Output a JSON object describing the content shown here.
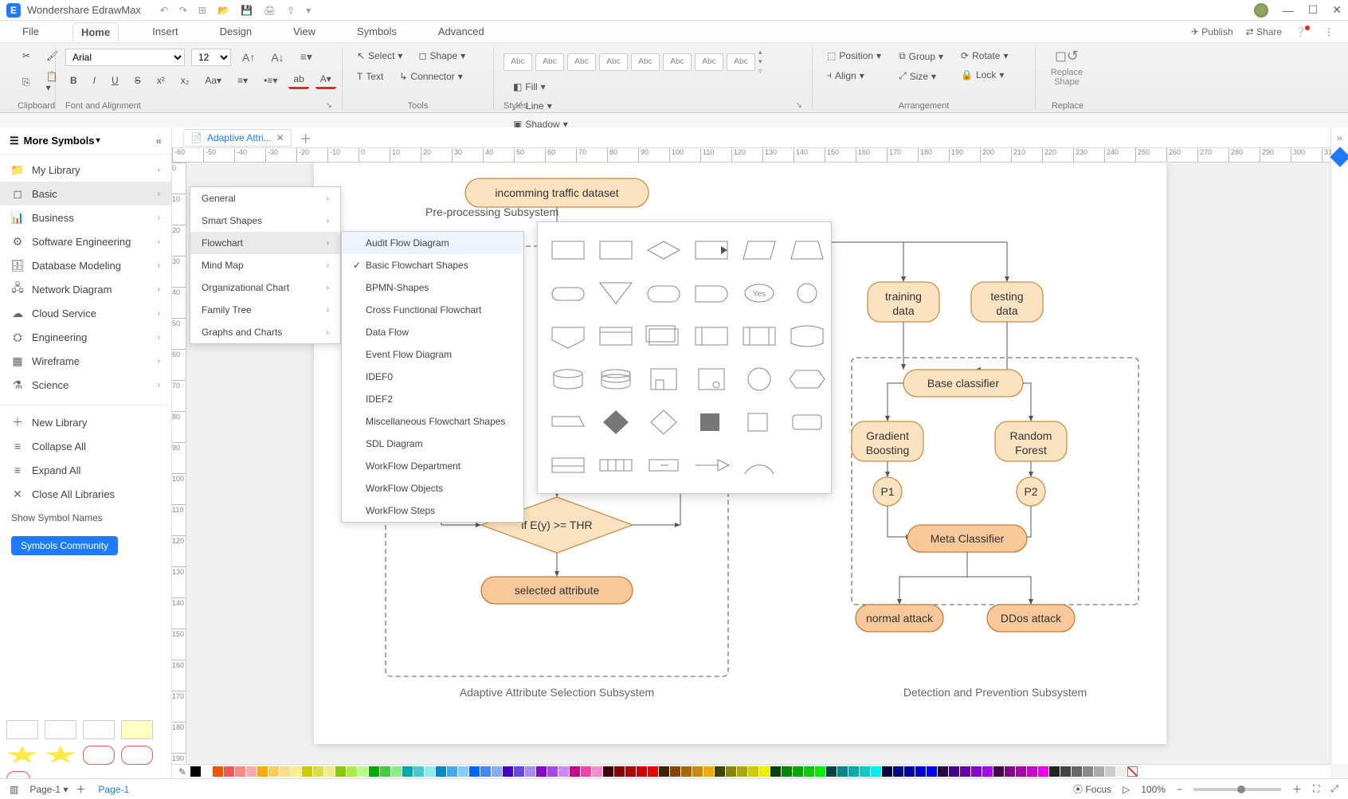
{
  "app": {
    "name": "Wondershare EdrawMax"
  },
  "menu": {
    "file": "File",
    "home": "Home",
    "insert": "Insert",
    "design": "Design",
    "view": "View",
    "symbols": "Symbols",
    "advanced": "Advanced",
    "publish": "Publish",
    "share": "Share"
  },
  "ribbon": {
    "clipboard": "Clipboard",
    "font_align": "Font and Alignment",
    "tools": "Tools",
    "styles": "Styles",
    "arrangement": "Arrangement",
    "replace": "Replace",
    "font": "Arial",
    "size": "12",
    "select": "Select",
    "shape": "Shape",
    "text": "Text",
    "connector": "Connector",
    "abc": "Abc",
    "fill": "Fill",
    "line": "Line",
    "shadow": "Shadow",
    "position": "Position",
    "align": "Align",
    "group": "Group",
    "size_btn": "Size",
    "rotate": "Rotate",
    "lock": "Lock",
    "replace_shape": "Replace\nShape"
  },
  "doctab": {
    "name": "Adaptive Attri..."
  },
  "sidebar": {
    "header": "More Symbols",
    "items": [
      {
        "icon": "📁",
        "label": "My Library"
      },
      {
        "icon": "◻",
        "label": "Basic",
        "active": true
      },
      {
        "icon": "📊",
        "label": "Business"
      },
      {
        "icon": "⚙",
        "label": "Software Engineering"
      },
      {
        "icon": "🗄",
        "label": "Database Modeling"
      },
      {
        "icon": "🖧",
        "label": "Network Diagram"
      },
      {
        "icon": "☁",
        "label": "Cloud Service"
      },
      {
        "icon": "⛭",
        "label": "Engineering"
      },
      {
        "icon": "▦",
        "label": "Wireframe"
      },
      {
        "icon": "⚗",
        "label": "Science"
      }
    ],
    "actions": [
      {
        "icon": "＋",
        "label": "New Library"
      },
      {
        "icon": "≡",
        "label": "Collapse All"
      },
      {
        "icon": "≡",
        "label": "Expand All"
      },
      {
        "icon": "✕",
        "label": "Close All Libraries"
      }
    ],
    "shownames": "Show Symbol Names",
    "community": "Symbols Community"
  },
  "submenu1": [
    "General",
    "Smart Shapes",
    "Flowchart",
    "Mind Map",
    "Organizational Chart",
    "Family Tree",
    "Graphs and Charts"
  ],
  "submenu1_active": "Flowchart",
  "submenu2": [
    {
      "label": "Audit Flow Diagram",
      "checked": false,
      "hover": true
    },
    {
      "label": "Basic Flowchart Shapes",
      "checked": true
    },
    {
      "label": "BPMN-Shapes"
    },
    {
      "label": "Cross Functional Flowchart"
    },
    {
      "label": "Data Flow"
    },
    {
      "label": "Event Flow Diagram"
    },
    {
      "label": "IDEF0"
    },
    {
      "label": "IDEF2"
    },
    {
      "label": "Miscellaneous Flowchart Shapes"
    },
    {
      "label": "SDL Diagram"
    },
    {
      "label": "WorkFlow Department"
    },
    {
      "label": "WorkFlow Objects"
    },
    {
      "label": "WorkFlow Steps"
    }
  ],
  "diagram": {
    "n_incoming": "incomming traffic dataset",
    "cap_preproc": "Pre-processing Subsystem",
    "n_training": "training\ndata",
    "n_testing": "testing\ndata",
    "n_base": "Base classifier",
    "n_gb": "Gradient\nBoosting",
    "n_rf": "Random\nForest",
    "n_p1": "P1",
    "n_p2": "P2",
    "n_meta": "Meta Classifier",
    "n_normal": "normal attack",
    "n_ddos": "DDos attack",
    "n_decision": "if E(y) >= THR",
    "n_selected": "selected attribute",
    "cap_left": "Adaptive Attribute Selection Subsystem",
    "cap_right": "Detection and Prevention Subsystem"
  },
  "gallery_yes": "Yes",
  "statusbar": {
    "pagebtn": "Page-1",
    "pagetab": "Page-1",
    "focus": "Focus",
    "zoom": "100%"
  }
}
